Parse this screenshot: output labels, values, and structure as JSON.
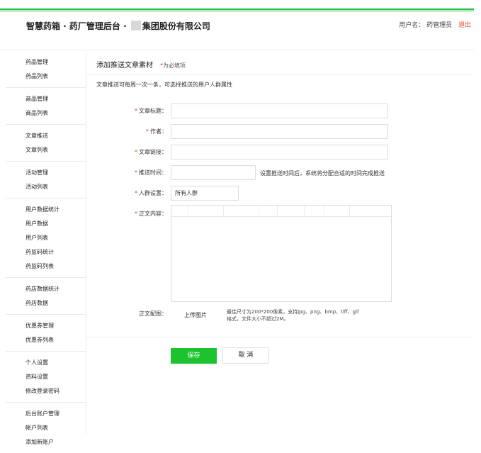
{
  "header": {
    "title_left": "智慧药箱 · 药厂管理后台 · ",
    "title_right": "集团股份有限公司",
    "user_label": "用户名：",
    "user_name": "药管理员",
    "logout": "退出"
  },
  "sidebar": {
    "groups": [
      [
        "药品管理",
        "药品列表"
      ],
      [
        "商品管理",
        "商品列表"
      ],
      [
        "文章推送",
        "文章列表"
      ],
      [
        "活动管理",
        "活动列表"
      ],
      [
        "用户数据统计",
        "用户数据",
        "用户列表",
        "药监码统计",
        "药监码列表"
      ],
      [
        "药店数据统计",
        "药店数据"
      ],
      [
        "优惠券管理",
        "优惠券列表"
      ],
      [
        "个人设置",
        "资料设置",
        "修改登录密码"
      ],
      [
        "后台账户管理",
        "帐户列表",
        "添加新账户"
      ]
    ]
  },
  "form": {
    "title": "添加推送文章素材",
    "required_mark": "*",
    "required_text": "为必填项",
    "hint": "文章推送可每周一次一条，可选择推送的用户人群属性",
    "fields": {
      "article_title": {
        "label": "文章标题：",
        "value": ""
      },
      "author": {
        "label": "作者：",
        "value": ""
      },
      "article_link": {
        "label": "文章链接：",
        "value": ""
      },
      "push_time": {
        "label": "推送时间：",
        "value": "",
        "note": "设置推送时间后，系统将分配合适的时间完成推送"
      },
      "audience": {
        "label": "人群设置：",
        "value": "所有人群"
      },
      "content": {
        "label": "正文内容：",
        "value": ""
      }
    },
    "image": {
      "label": "正文配图：",
      "upload_button": "上传图片",
      "note": "最佳尺寸为200*200像素，支持jpg、png、bmp、tiff、gif格式，文件大小不超过2M。"
    },
    "save": "保存",
    "cancel": "取 消"
  }
}
